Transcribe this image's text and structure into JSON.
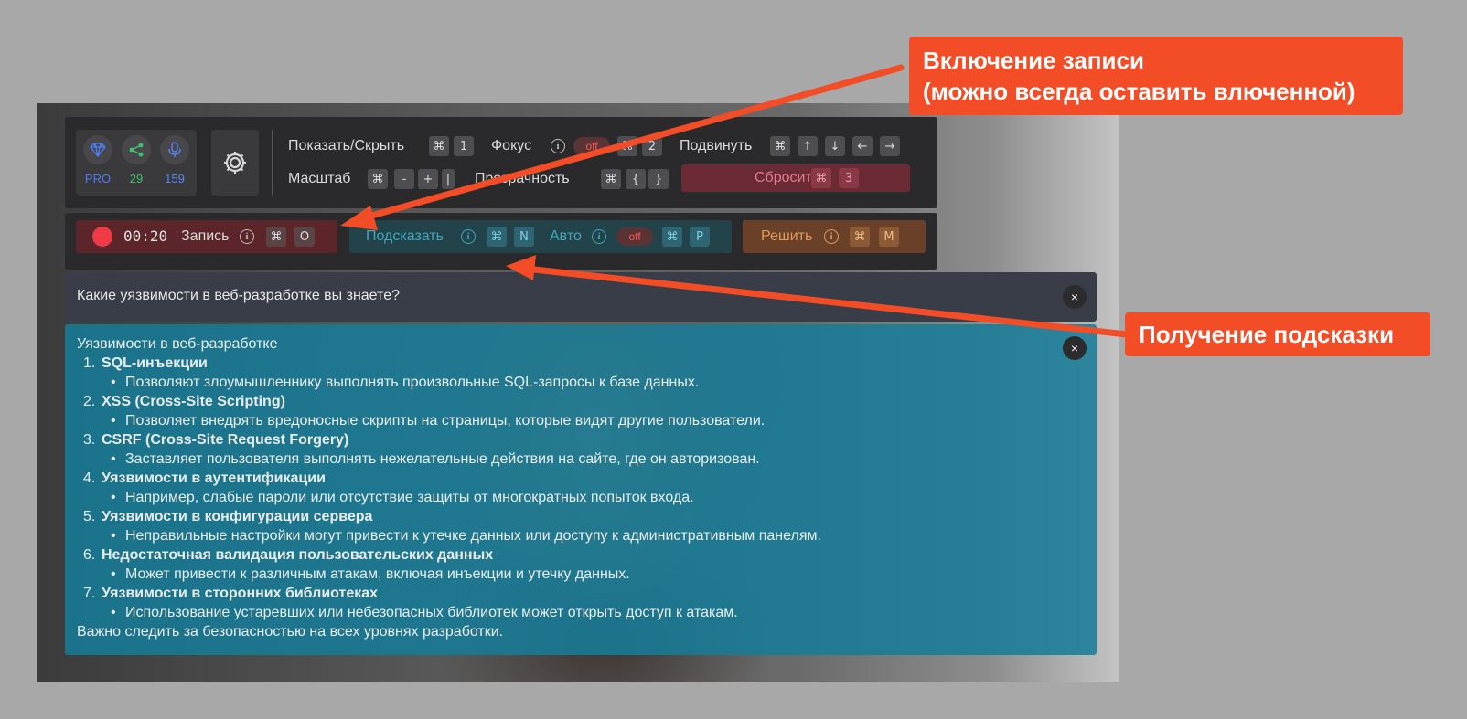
{
  "stats": {
    "pro_label": "PRO",
    "share_count": "29",
    "mic_count": "159",
    "colors": {
      "pro": "#4f7cf5",
      "share": "#3ec46d",
      "mic": "#5a85f0"
    }
  },
  "toolbar": {
    "show_hide_label": "Показать/Скрыть",
    "show_hide_key": "1",
    "focus_label": "Фокус",
    "focus_toggle": "off",
    "focus_key": "2",
    "move_label": "Подвинуть",
    "scale_label": "Масштаб",
    "scale_minus": "-",
    "scale_plus": "+",
    "transparency_label": "Прозрачность",
    "transparency_dec": "{",
    "transparency_inc": "}",
    "reset_label": "Сбросить",
    "reset_key": "3",
    "cmd_glyph": "⌘"
  },
  "record": {
    "time": "00:20",
    "label": "Запись",
    "key": "O"
  },
  "hint": {
    "label": "Подсказать",
    "key": "N",
    "auto_label": "Авто",
    "auto_toggle": "off",
    "auto_key": "P"
  },
  "solve": {
    "label": "Решить",
    "key": "M"
  },
  "question": {
    "text": "Какие уязвимости в веб-разработке вы знаете?"
  },
  "answer": {
    "title": "Уязвимости в веб-разработке",
    "items": [
      {
        "num": "1.",
        "title": "SQL-инъекции",
        "desc": "Позволяют злоумышленнику выполнять произвольные SQL-запросы к базе данных."
      },
      {
        "num": "2.",
        "title": "XSS (Cross-Site Scripting)",
        "desc": "Позволяет внедрять вредоносные скрипты на страницы, которые видят другие пользователи."
      },
      {
        "num": "3.",
        "title": "CSRF (Cross-Site Request Forgery)",
        "desc": "Заставляет пользователя выполнять нежелательные действия на сайте, где он авторизован."
      },
      {
        "num": "4.",
        "title": "Уязвимости в аутентификации",
        "desc": "Например, слабые пароли или отсутствие защиты от многократных попыток входа."
      },
      {
        "num": "5.",
        "title": "Уязвимости в конфигурации сервера",
        "desc": "Неправильные настройки могут привести к утечке данных или доступу к административным панелям."
      },
      {
        "num": "6.",
        "title": "Недостаточная валидация пользовательских данных",
        "desc": "Может привести к различным атакам, включая инъекции и утечку данных."
      },
      {
        "num": "7.",
        "title": "Уязвимости в сторонних библиотеках",
        "desc": "Использование устаревших или небезопасных библиотек может открыть доступ к атакам."
      }
    ],
    "footer": "Важно следить за безопасностью на всех уровнях разработки."
  },
  "callouts": {
    "record_line1": "Включение записи",
    "record_line2": "(можно всегда оставить влюченной)",
    "hint": "Получение подсказки",
    "color": "#f24d26"
  },
  "close_glyph": "×"
}
